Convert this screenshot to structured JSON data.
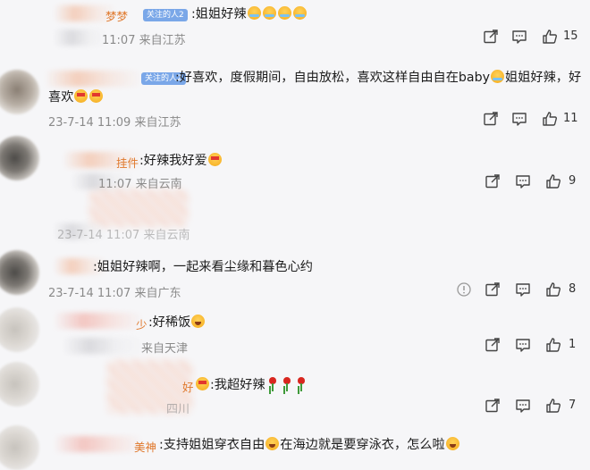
{
  "comments": [
    {
      "name": "梦梦",
      "badge": "关注的人2",
      "text": ":姐姐好辣",
      "meta": "11:07 来自江苏",
      "likes": "15"
    },
    {
      "name": "",
      "badge": "关注的人2",
      "text_line1": ":好喜欢，度假期间，自由放松，喜欢这样自由自在baby",
      "text_line1b": "姐姐好辣，好",
      "text_line2": "喜欢",
      "meta": "23-7-14 11:09 来自江苏",
      "likes": "11"
    },
    {
      "name": "挂件",
      "text": ":好辣我好爱",
      "meta": "11:07 来自云南",
      "likes": "9"
    },
    {
      "meta": "23-7-14 11:07 来自云南"
    },
    {
      "text": ":姐姐好辣啊，一起来看尘缘和暮色心约",
      "meta": "23-7-14 11:07 来自广东",
      "likes": "8"
    },
    {
      "name": "少",
      "text": ":好稀饭",
      "meta": "来自天津",
      "likes": "1"
    },
    {
      "name": "好",
      "text": ":我超好辣",
      "meta": "四川",
      "likes": "7"
    },
    {
      "name": "美神",
      "text": ":支持姐姐穿衣自由",
      "text2": "在海边就是要穿泳衣，怎么啦"
    }
  ],
  "icons": {
    "share": "share-icon",
    "comment": "comment-icon",
    "like": "thumbs-up-icon",
    "report": "report-icon"
  },
  "colors": {
    "name": "#e0792d",
    "badge": "#7aa7e8",
    "meta": "#8a8a8a"
  }
}
